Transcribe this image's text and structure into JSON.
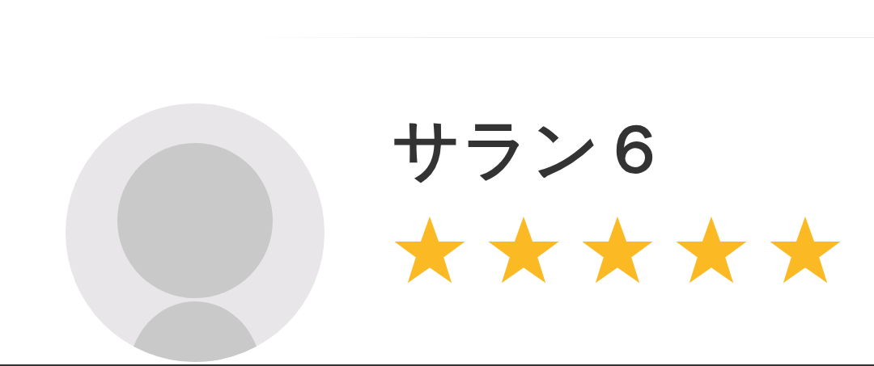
{
  "profile": {
    "name": "サラン６",
    "stars": 5
  }
}
